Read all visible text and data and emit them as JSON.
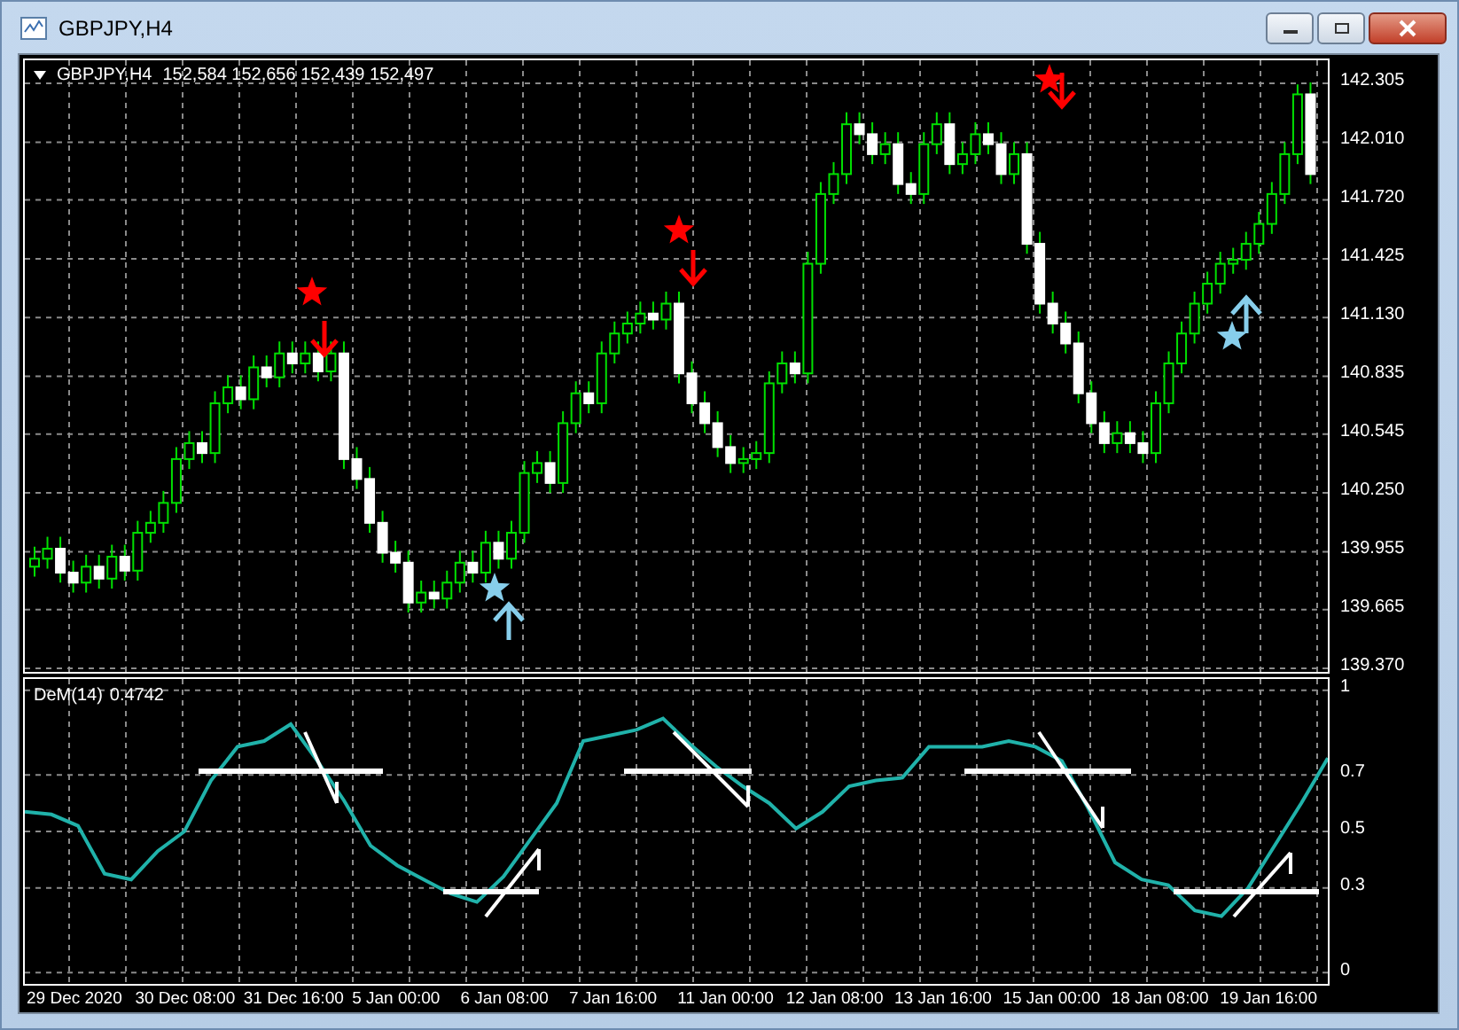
{
  "window": {
    "title": "GBPJPY,H4"
  },
  "chart": {
    "symbol": "GBPJPY,H4",
    "quote": "152,584 152,656 152,439 152,497",
    "chart_data": {
      "type": "candlestick",
      "grid": true,
      "ylim": [
        139.352,
        142.421
      ],
      "yticks": [
        {
          "value": 142.305,
          "label": "142.305"
        },
        {
          "value": 142.01,
          "label": "142.010"
        },
        {
          "value": 141.72,
          "label": "141.720"
        },
        {
          "value": 141.425,
          "label": "141.425"
        },
        {
          "value": 141.13,
          "label": "141.130"
        },
        {
          "value": 140.835,
          "label": "140.835"
        },
        {
          "value": 140.545,
          "label": "140.545"
        },
        {
          "value": 140.25,
          "label": "140.250"
        },
        {
          "value": 139.955,
          "label": "139.955"
        },
        {
          "value": 139.665,
          "label": "139.665"
        },
        {
          "value": 139.37,
          "label": "139.370"
        }
      ],
      "ohlc": [
        [
          139.88,
          139.98,
          139.83,
          139.92
        ],
        [
          139.92,
          140.03,
          139.87,
          139.97
        ],
        [
          139.97,
          140.03,
          139.8,
          139.85
        ],
        [
          139.85,
          139.91,
          139.75,
          139.8
        ],
        [
          139.8,
          139.94,
          139.75,
          139.88
        ],
        [
          139.88,
          139.94,
          139.77,
          139.82
        ],
        [
          139.82,
          139.99,
          139.77,
          139.93
        ],
        [
          139.93,
          139.99,
          139.81,
          139.86
        ],
        [
          139.86,
          140.11,
          139.81,
          140.05
        ],
        [
          140.05,
          140.16,
          140.0,
          140.1
        ],
        [
          140.1,
          140.26,
          140.05,
          140.2
        ],
        [
          140.2,
          140.48,
          140.15,
          140.42
        ],
        [
          140.42,
          140.56,
          140.37,
          140.5
        ],
        [
          140.5,
          140.56,
          140.4,
          140.45
        ],
        [
          140.45,
          140.76,
          140.4,
          140.7
        ],
        [
          140.7,
          140.84,
          140.65,
          140.78
        ],
        [
          140.78,
          140.84,
          140.67,
          140.72
        ],
        [
          140.72,
          140.94,
          140.67,
          140.88
        ],
        [
          140.88,
          140.94,
          140.78,
          140.83
        ],
        [
          140.83,
          141.01,
          140.78,
          140.95
        ],
        [
          140.95,
          141.01,
          140.85,
          140.9
        ],
        [
          140.9,
          141.01,
          140.85,
          140.95
        ],
        [
          140.95,
          141.01,
          140.81,
          140.86
        ],
        [
          140.86,
          141.01,
          140.81,
          140.95
        ],
        [
          140.95,
          141.01,
          140.37,
          140.42
        ],
        [
          140.42,
          140.48,
          140.27,
          140.32
        ],
        [
          140.32,
          140.38,
          140.05,
          140.1
        ],
        [
          140.1,
          140.16,
          139.9,
          139.95
        ],
        [
          139.95,
          140.01,
          139.85,
          139.9
        ],
        [
          139.9,
          139.96,
          139.65,
          139.7
        ],
        [
          139.7,
          139.81,
          139.65,
          139.75
        ],
        [
          139.75,
          139.81,
          139.67,
          139.72
        ],
        [
          139.72,
          139.86,
          139.67,
          139.8
        ],
        [
          139.8,
          139.96,
          139.75,
          139.9
        ],
        [
          139.9,
          139.96,
          139.8,
          139.85
        ],
        [
          139.85,
          140.06,
          139.8,
          140.0
        ],
        [
          140.0,
          140.06,
          139.87,
          139.92
        ],
        [
          139.92,
          140.11,
          139.87,
          140.05
        ],
        [
          140.05,
          140.41,
          140.0,
          140.35
        ],
        [
          140.35,
          140.46,
          140.3,
          140.4
        ],
        [
          140.4,
          140.46,
          140.25,
          140.3
        ],
        [
          140.3,
          140.66,
          140.25,
          140.6
        ],
        [
          140.6,
          140.81,
          140.55,
          140.75
        ],
        [
          140.75,
          140.81,
          140.65,
          140.7
        ],
        [
          140.7,
          141.01,
          140.65,
          140.95
        ],
        [
          140.95,
          141.11,
          140.9,
          141.05
        ],
        [
          141.05,
          141.16,
          141.0,
          141.1
        ],
        [
          141.1,
          141.21,
          141.05,
          141.15
        ],
        [
          141.15,
          141.21,
          141.07,
          141.12
        ],
        [
          141.12,
          141.26,
          141.07,
          141.2
        ],
        [
          141.2,
          141.26,
          140.8,
          140.85
        ],
        [
          140.85,
          140.91,
          140.65,
          140.7
        ],
        [
          140.7,
          140.76,
          140.55,
          140.6
        ],
        [
          140.6,
          140.66,
          140.43,
          140.48
        ],
        [
          140.48,
          140.54,
          140.35,
          140.4
        ],
        [
          140.4,
          140.48,
          140.35,
          140.42
        ],
        [
          140.42,
          140.51,
          140.37,
          140.45
        ],
        [
          140.45,
          140.86,
          140.4,
          140.8
        ],
        [
          140.8,
          140.96,
          140.75,
          140.9
        ],
        [
          140.9,
          140.96,
          140.8,
          140.85
        ],
        [
          140.85,
          141.46,
          140.8,
          141.4
        ],
        [
          141.4,
          141.81,
          141.35,
          141.75
        ],
        [
          141.75,
          141.91,
          141.7,
          141.85
        ],
        [
          141.85,
          142.16,
          141.8,
          142.1
        ],
        [
          142.1,
          142.16,
          142.0,
          142.05
        ],
        [
          142.05,
          142.11,
          141.9,
          141.95
        ],
        [
          141.95,
          142.06,
          141.9,
          142.0
        ],
        [
          142.0,
          142.06,
          141.75,
          141.8
        ],
        [
          141.8,
          141.86,
          141.7,
          141.75
        ],
        [
          141.75,
          142.06,
          141.7,
          142.0
        ],
        [
          142.0,
          142.16,
          141.95,
          142.1
        ],
        [
          142.1,
          142.16,
          141.85,
          141.9
        ],
        [
          141.9,
          142.01,
          141.85,
          141.95
        ],
        [
          141.95,
          142.11,
          141.9,
          142.05
        ],
        [
          142.05,
          142.11,
          141.95,
          142.0
        ],
        [
          142.0,
          142.06,
          141.8,
          141.85
        ],
        [
          141.85,
          142.01,
          141.8,
          141.95
        ],
        [
          141.95,
          142.01,
          141.45,
          141.5
        ],
        [
          141.5,
          141.56,
          141.15,
          141.2
        ],
        [
          141.2,
          141.26,
          141.05,
          141.1
        ],
        [
          141.1,
          141.16,
          140.95,
          141.0
        ],
        [
          141.0,
          141.06,
          140.7,
          140.75
        ],
        [
          140.75,
          140.81,
          140.55,
          140.6
        ],
        [
          140.6,
          140.66,
          140.45,
          140.5
        ],
        [
          140.5,
          140.61,
          140.45,
          140.55
        ],
        [
          140.55,
          140.61,
          140.45,
          140.5
        ],
        [
          140.5,
          140.56,
          140.4,
          140.45
        ],
        [
          140.45,
          140.76,
          140.4,
          140.7
        ],
        [
          140.7,
          140.96,
          140.65,
          140.9
        ],
        [
          140.9,
          141.11,
          140.85,
          141.05
        ],
        [
          141.05,
          141.26,
          141.0,
          141.2
        ],
        [
          141.2,
          141.36,
          141.15,
          141.3
        ],
        [
          141.3,
          141.46,
          141.25,
          141.4
        ],
        [
          141.4,
          141.48,
          141.35,
          141.42
        ],
        [
          141.42,
          141.56,
          141.37,
          141.5
        ],
        [
          141.5,
          141.66,
          141.45,
          141.6
        ],
        [
          141.6,
          141.81,
          141.55,
          141.75
        ],
        [
          141.75,
          142.01,
          141.7,
          141.95
        ],
        [
          141.95,
          142.3,
          141.9,
          142.25
        ],
        [
          142.25,
          142.31,
          141.8,
          141.85
        ]
      ]
    }
  },
  "indicator": {
    "value": "0.4742",
    "chart_data": {
      "type": "line",
      "grid": true,
      "ylim": [
        -0.04,
        1.04
      ],
      "yticks": [
        {
          "value": 1,
          "label": "1"
        },
        {
          "value": 0.7,
          "label": "0.7"
        },
        {
          "value": 0.5,
          "label": "0.5"
        },
        {
          "value": 0.3,
          "label": "0.3"
        },
        {
          "value": 0,
          "label": "0"
        }
      ],
      "series": [
        {
          "name": "DeM(14)",
          "color": "#20b2aa",
          "values": [
            0.57,
            0.56,
            0.52,
            0.35,
            0.33,
            0.43,
            0.5,
            0.68,
            0.8,
            0.82,
            0.88,
            0.75,
            0.61,
            0.45,
            0.38,
            0.33,
            0.28,
            0.25,
            0.34,
            0.47,
            0.6,
            0.82,
            0.84,
            0.86,
            0.9,
            0.81,
            0.73,
            0.66,
            0.6,
            0.51,
            0.57,
            0.66,
            0.68,
            0.69,
            0.8,
            0.8,
            0.8,
            0.82,
            0.8,
            0.75,
            0.58,
            0.39,
            0.33,
            0.31,
            0.22,
            0.2,
            0.3,
            0.45,
            0.6,
            0.76
          ]
        }
      ]
    }
  },
  "time_labels": [
    "29 Dec 2020",
    "30 Dec 08:00",
    "31 Dec 16:00",
    "5 Jan 00:00",
    "6 Jan 08:00",
    "7 Jan 16:00",
    "11 Jan 00:00",
    "12 Jan 08:00",
    "13 Jan 16:00",
    "15 Jan 00:00",
    "18 Jan 08:00",
    "19 Jan 16:00"
  ]
}
